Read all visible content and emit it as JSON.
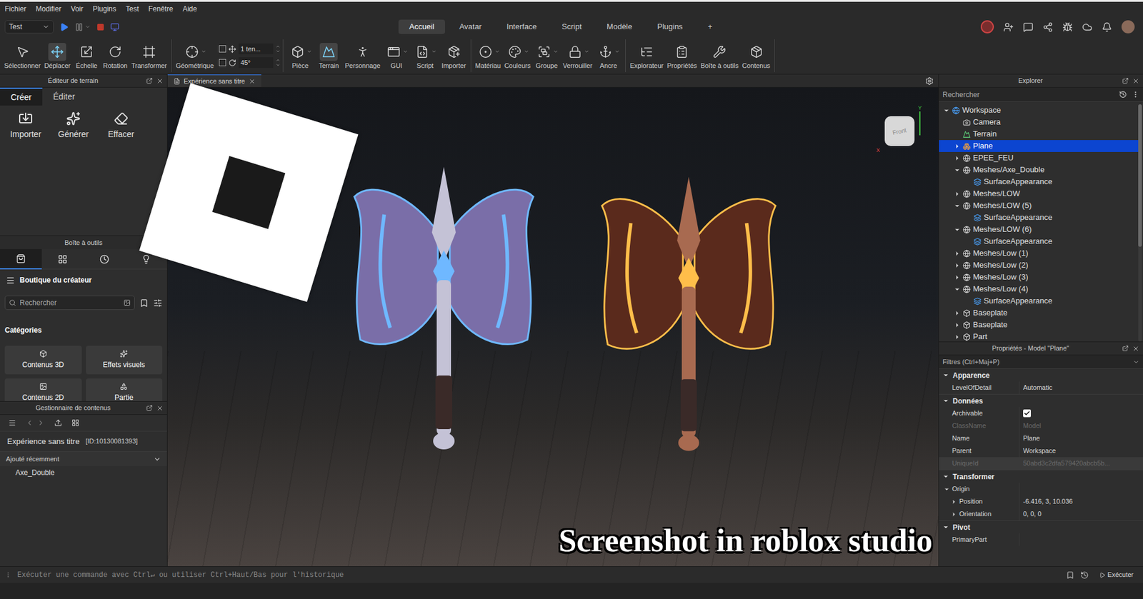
{
  "menu": [
    "Fichier",
    "Modifier",
    "Voir",
    "Plugins",
    "Test",
    "Fenêtre",
    "Aide"
  ],
  "mode_select": {
    "value": "Test"
  },
  "ribbon_tabs": [
    {
      "label": "Accueil",
      "selected": true
    },
    {
      "label": "Avatar",
      "selected": false
    },
    {
      "label": "Interface",
      "selected": false
    },
    {
      "label": "Script",
      "selected": false
    },
    {
      "label": "Modèle",
      "selected": false
    },
    {
      "label": "Plugins",
      "selected": false
    },
    {
      "label": "+",
      "selected": false
    }
  ],
  "toolbar": {
    "groups": [
      {
        "tools": [
          {
            "label": "Sélectionner",
            "selected": false,
            "dropdown": false
          },
          {
            "label": "Déplacer",
            "selected": true,
            "dropdown": false
          },
          {
            "label": "Échelle",
            "selected": false,
            "dropdown": false
          },
          {
            "label": "Rotation",
            "selected": false,
            "dropdown": false
          },
          {
            "label": "Transformer",
            "selected": false,
            "dropdown": false
          }
        ]
      },
      {
        "tools": [
          {
            "label": "Géométrique",
            "selected": false,
            "dropdown": true
          }
        ],
        "snap": [
          {
            "value": "1 ten...",
            "checked": false
          },
          {
            "value": "45°",
            "checked": false
          }
        ]
      },
      {
        "tools": [
          {
            "label": "Pièce",
            "selected": false,
            "dropdown": true
          },
          {
            "label": "Terrain",
            "selected": true,
            "dropdown": false
          },
          {
            "label": "Personnage",
            "selected": false,
            "dropdown": false
          },
          {
            "label": "GUI",
            "selected": false,
            "dropdown": true
          },
          {
            "label": "Script",
            "selected": false,
            "dropdown": true
          },
          {
            "label": "Importer",
            "selected": false,
            "dropdown": false
          }
        ]
      },
      {
        "tools": [
          {
            "label": "Matériau",
            "selected": false,
            "dropdown": true
          },
          {
            "label": "Couleurs",
            "selected": false,
            "dropdown": true
          },
          {
            "label": "Groupe",
            "selected": false,
            "dropdown": true
          },
          {
            "label": "Verrouiller",
            "selected": false,
            "dropdown": true
          },
          {
            "label": "Ancre",
            "selected": false,
            "dropdown": true
          }
        ]
      },
      {
        "tools": [
          {
            "label": "Explorateur",
            "selected": false,
            "dropdown": false
          },
          {
            "label": "Propriétés",
            "selected": false,
            "dropdown": false
          },
          {
            "label": "Boîte à outils",
            "selected": false,
            "dropdown": false
          },
          {
            "label": "Contenus",
            "selected": false,
            "dropdown": false
          }
        ]
      }
    ]
  },
  "terrain_editor": {
    "title": "Éditeur de terrain",
    "tabs": [
      {
        "label": "Créer",
        "selected": true
      },
      {
        "label": "Éditer",
        "selected": false
      }
    ],
    "actions": [
      "Importer",
      "Générer",
      "Effacer"
    ]
  },
  "toolbox": {
    "title": "Boîte à outils",
    "tabs": [
      {
        "selected": true
      },
      {
        "selected": false
      },
      {
        "selected": false
      },
      {
        "selected": false
      }
    ],
    "store": "Boutique du créateur",
    "search": {
      "placeholder": "Rechercher"
    },
    "categories_title": "Catégories",
    "categories": [
      "Contenus 3D",
      "Effets visuels",
      "Contenus 2D",
      "Partie"
    ]
  },
  "content_manager": {
    "title": "Gestionnaire de contenus",
    "experience": "Expérience sans titre",
    "id": "[ID:10130081393]",
    "section": {
      "label": "Ajouté récemment",
      "expanded": true
    },
    "items": [
      "Axe_Double"
    ]
  },
  "viewport": {
    "tab": {
      "label": "Expérience sans titre"
    },
    "view_cube": "Front",
    "axes": [
      "Y",
      "X"
    ],
    "overlay_caption": "Screenshot in roblox studio"
  },
  "explorer": {
    "title": "Explorer",
    "search": {
      "placeholder": "Rechercher"
    },
    "items": [
      {
        "label": "Workspace",
        "depth": 0,
        "kind": "workspace",
        "has_children": true,
        "expanded": true,
        "selected": false
      },
      {
        "label": "Camera",
        "depth": 1,
        "kind": "camera",
        "has_children": false,
        "expanded": false,
        "selected": false
      },
      {
        "label": "Terrain",
        "depth": 1,
        "kind": "terrain",
        "has_children": false,
        "expanded": false,
        "selected": false
      },
      {
        "label": "Plane",
        "depth": 1,
        "kind": "model",
        "has_children": true,
        "expanded": false,
        "selected": true
      },
      {
        "label": "EPEE_FEU",
        "depth": 1,
        "kind": "mesh",
        "has_children": true,
        "expanded": false,
        "selected": false
      },
      {
        "label": "Meshes/Axe_Double",
        "depth": 1,
        "kind": "mesh",
        "has_children": true,
        "expanded": true,
        "selected": false
      },
      {
        "label": "SurfaceAppearance",
        "depth": 2,
        "kind": "surface",
        "has_children": false,
        "expanded": false,
        "selected": false
      },
      {
        "label": "Meshes/LOW",
        "depth": 1,
        "kind": "mesh",
        "has_children": true,
        "expanded": false,
        "selected": false
      },
      {
        "label": "Meshes/LOW (5)",
        "depth": 1,
        "kind": "mesh",
        "has_children": true,
        "expanded": true,
        "selected": false
      },
      {
        "label": "SurfaceAppearance",
        "depth": 2,
        "kind": "surface",
        "has_children": false,
        "expanded": false,
        "selected": false
      },
      {
        "label": "Meshes/LOW (6)",
        "depth": 1,
        "kind": "mesh",
        "has_children": true,
        "expanded": true,
        "selected": false
      },
      {
        "label": "SurfaceAppearance",
        "depth": 2,
        "kind": "surface",
        "has_children": false,
        "expanded": false,
        "selected": false
      },
      {
        "label": "Meshes/Low (1)",
        "depth": 1,
        "kind": "mesh",
        "has_children": true,
        "expanded": false,
        "selected": false
      },
      {
        "label": "Meshes/Low (2)",
        "depth": 1,
        "kind": "mesh",
        "has_children": true,
        "expanded": false,
        "selected": false
      },
      {
        "label": "Meshes/Low (3)",
        "depth": 1,
        "kind": "mesh",
        "has_children": true,
        "expanded": false,
        "selected": false
      },
      {
        "label": "Meshes/Low (4)",
        "depth": 1,
        "kind": "mesh",
        "has_children": true,
        "expanded": true,
        "selected": false
      },
      {
        "label": "SurfaceAppearance",
        "depth": 2,
        "kind": "surface",
        "has_children": false,
        "expanded": false,
        "selected": false
      },
      {
        "label": "Baseplate",
        "depth": 1,
        "kind": "part",
        "has_children": true,
        "expanded": false,
        "selected": false
      },
      {
        "label": "Baseplate",
        "depth": 1,
        "kind": "part",
        "has_children": true,
        "expanded": false,
        "selected": false
      },
      {
        "label": "Part",
        "depth": 1,
        "kind": "part",
        "has_children": true,
        "expanded": false,
        "selected": false
      }
    ]
  },
  "properties": {
    "title": "Propriétés - Model \"Plane\"",
    "filter": "Filtres (Ctrl+Maj+P)",
    "sections": [
      {
        "label": "Apparence",
        "expanded": true,
        "rows": [
          {
            "name": "LevelOfDetail",
            "value": "Automatic",
            "kind": "text",
            "disabled": false,
            "depth": 0,
            "expandable": false,
            "expanded": false,
            "highlighted": false
          }
        ]
      },
      {
        "label": "Données",
        "expanded": true,
        "rows": [
          {
            "name": "Archivable",
            "value": "",
            "kind": "checkbox",
            "checked": true,
            "disabled": false,
            "depth": 0,
            "expandable": false,
            "expanded": false,
            "highlighted": false
          },
          {
            "name": "ClassName",
            "value": "Model",
            "kind": "text",
            "disabled": true,
            "depth": 0,
            "expandable": false,
            "expanded": false,
            "highlighted": false
          },
          {
            "name": "Name",
            "value": "Plane",
            "kind": "text",
            "disabled": false,
            "depth": 0,
            "expandable": false,
            "expanded": false,
            "highlighted": false
          },
          {
            "name": "Parent",
            "value": "Workspace",
            "kind": "text",
            "disabled": false,
            "depth": 0,
            "expandable": false,
            "expanded": false,
            "highlighted": false
          },
          {
            "name": "UniqueId",
            "value": "50abd3c2dfa579420abcb5b...",
            "kind": "text",
            "disabled": true,
            "depth": 0,
            "expandable": false,
            "expanded": false,
            "highlighted": true
          }
        ]
      },
      {
        "label": "Transformer",
        "expanded": true,
        "rows": [
          {
            "name": "Origin",
            "value": "",
            "kind": "text",
            "disabled": false,
            "depth": 0,
            "expandable": true,
            "expanded": true,
            "highlighted": false
          },
          {
            "name": "Position",
            "value": "-6.416, 3, 10.036",
            "kind": "text",
            "disabled": false,
            "depth": 1,
            "expandable": true,
            "expanded": false,
            "highlighted": false
          },
          {
            "name": "Orientation",
            "value": "0, 0, 0",
            "kind": "text",
            "disabled": false,
            "depth": 1,
            "expandable": true,
            "expanded": false,
            "highlighted": false
          }
        ]
      },
      {
        "label": "Pivot",
        "expanded": true,
        "rows": [
          {
            "name": "PrimaryPart",
            "value": "",
            "kind": "text",
            "disabled": false,
            "depth": 0,
            "expandable": false,
            "expanded": false,
            "highlighted": false
          }
        ]
      }
    ]
  },
  "command_bar": {
    "placeholder": "Exécuter une commande avec Ctrl↵ ou utiliser Ctrl+Haut/Bas pour l'historique",
    "run": "Exécuter"
  }
}
